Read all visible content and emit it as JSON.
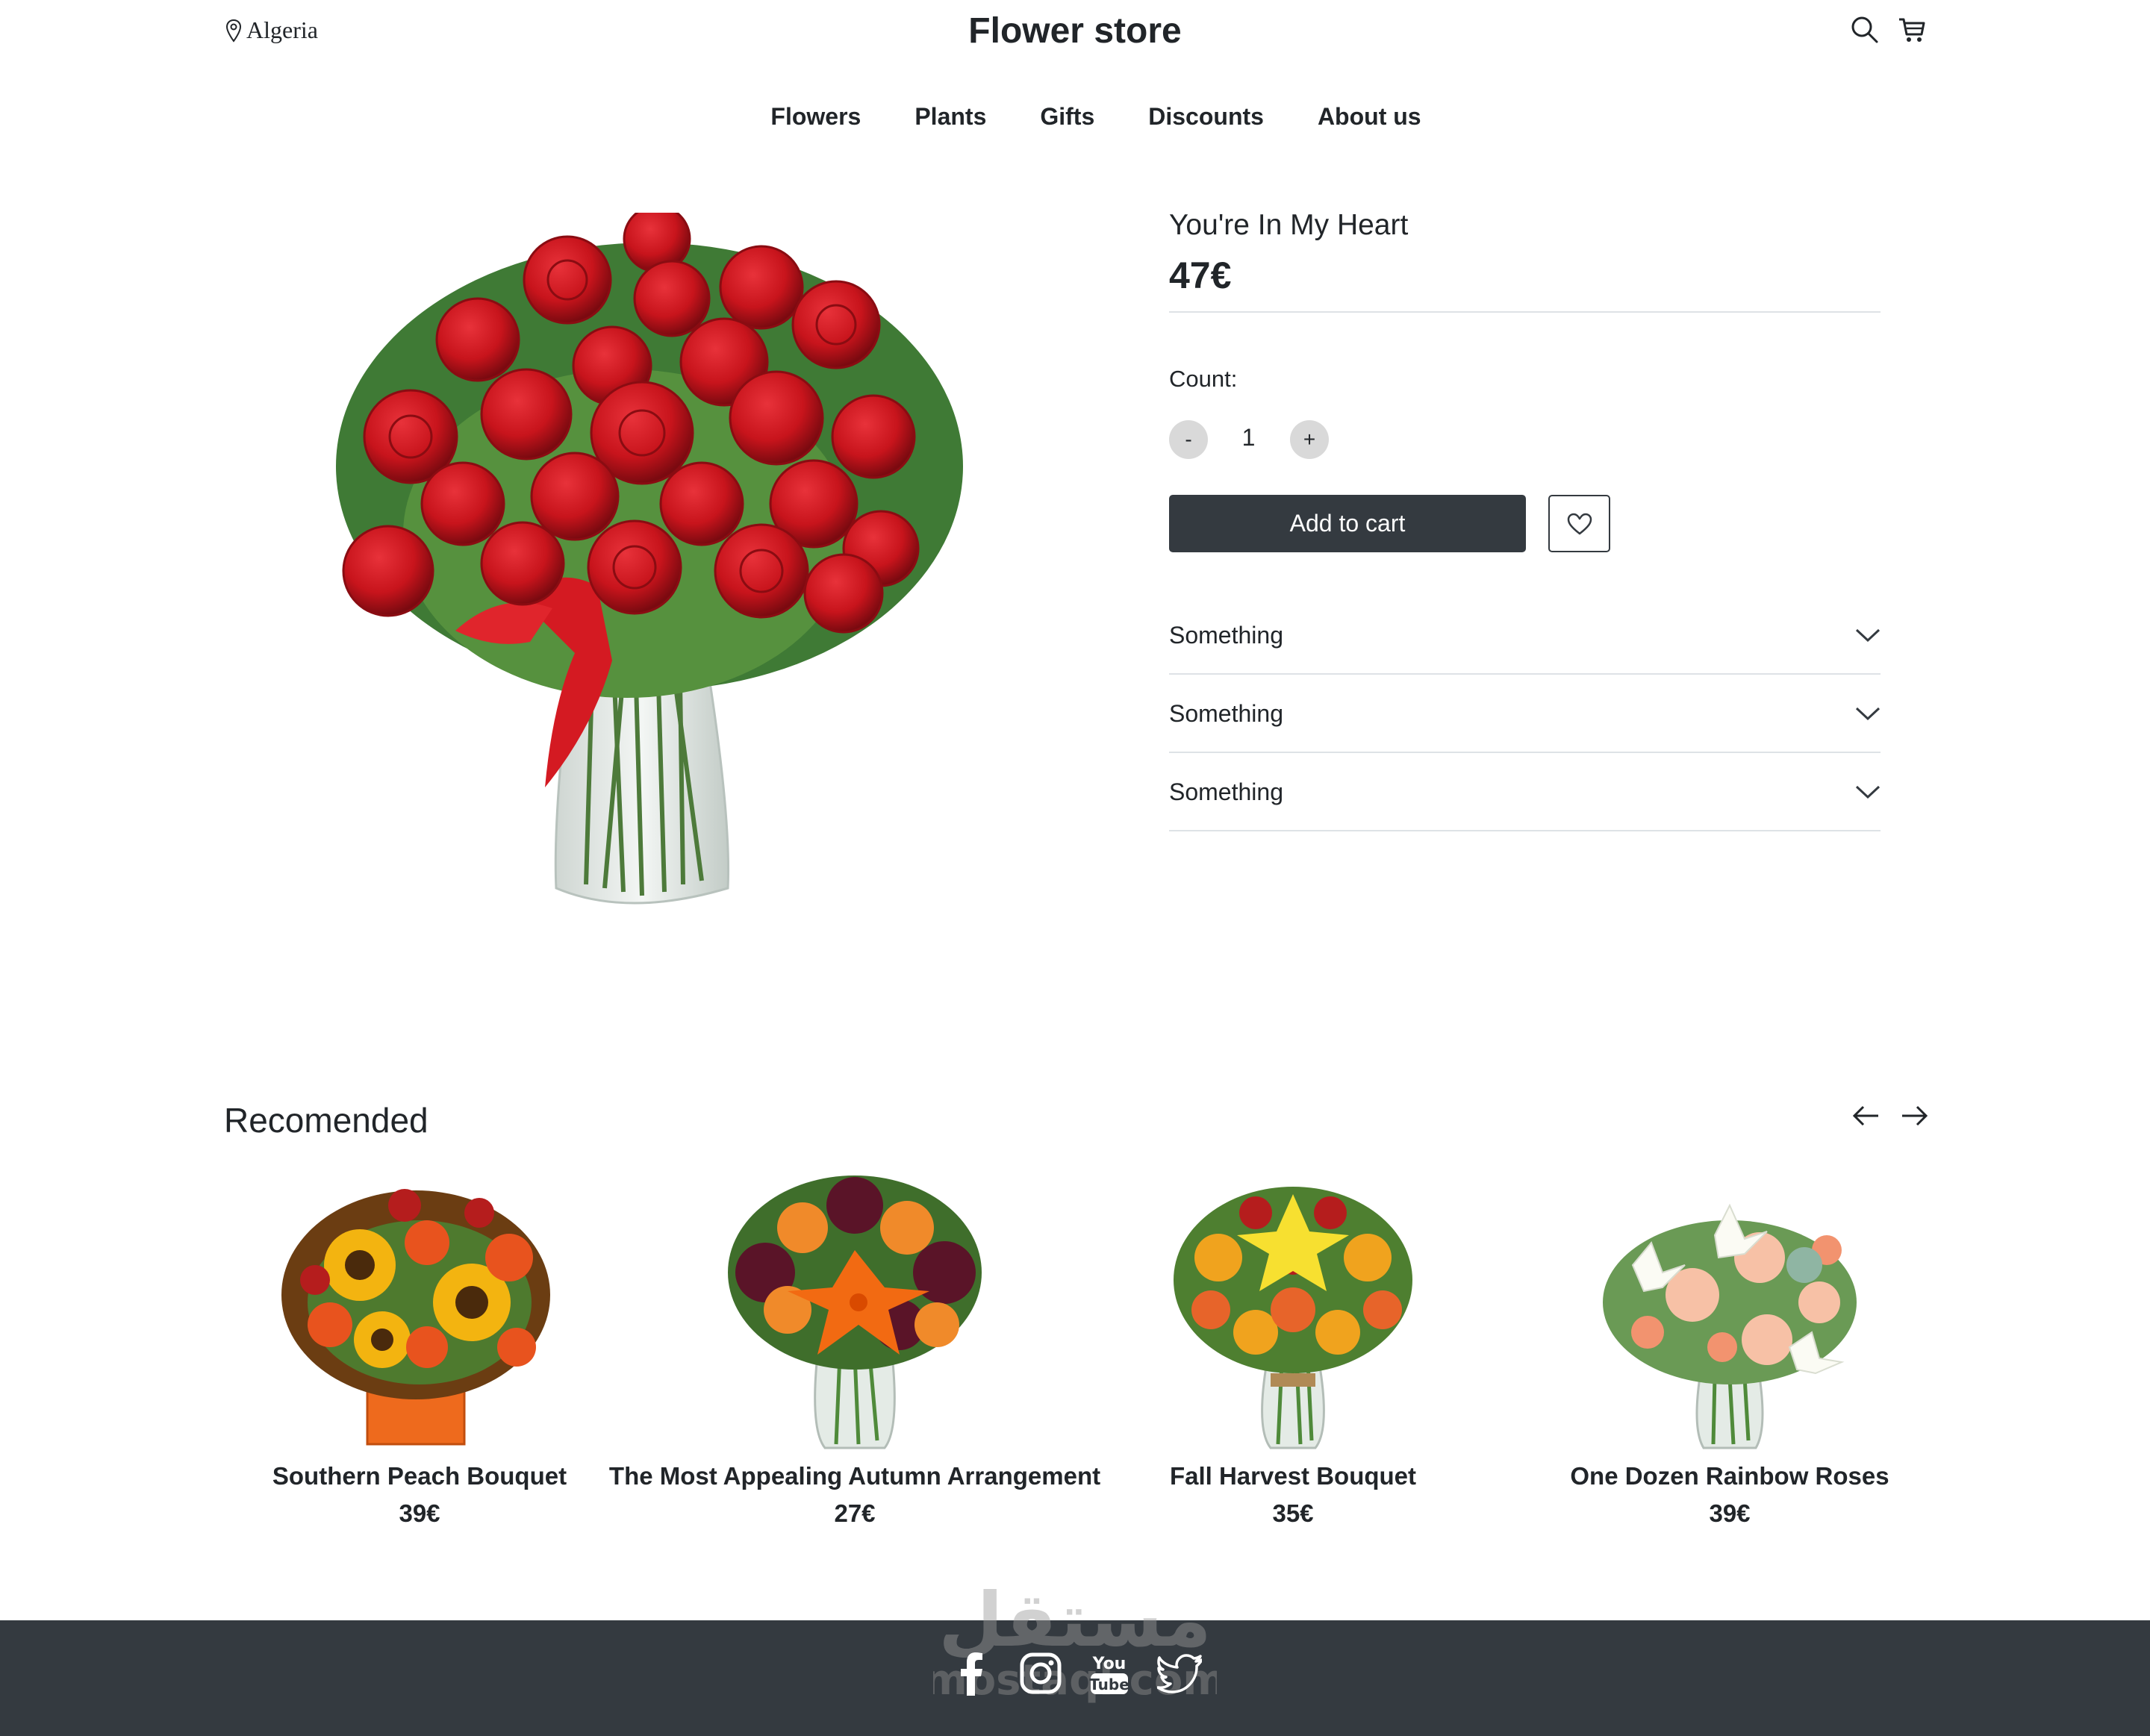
{
  "header": {
    "location": "Algeria",
    "brand": "Flower store",
    "icons": [
      "map-pin-icon",
      "search-icon",
      "cart-icon"
    ]
  },
  "nav": [
    {
      "label": "Flowers"
    },
    {
      "label": "Plants"
    },
    {
      "label": "Gifts"
    },
    {
      "label": "Discounts"
    },
    {
      "label": "About us"
    }
  ],
  "product": {
    "title": "You're In My Heart",
    "price": "47€",
    "count_label": "Count:",
    "count": "1",
    "minus_label": "-",
    "plus_label": "+",
    "add_to_cart": "Add to cart",
    "accordion": [
      {
        "label": "Something"
      },
      {
        "label": "Something"
      },
      {
        "label": "Something"
      }
    ]
  },
  "recommended": {
    "title": "Recomended",
    "items": [
      {
        "name": "Southern Peach Bouquet",
        "price": "39€"
      },
      {
        "name": "The Most Appealing Autumn Arrangement",
        "price": "27€"
      },
      {
        "name": "Fall Harvest Bouquet",
        "price": "35€"
      },
      {
        "name": "One Dozen Rainbow Roses",
        "price": "39€"
      }
    ]
  },
  "footer": {
    "social": [
      "facebook-icon",
      "instagram-icon",
      "youtube-icon",
      "twitter-icon"
    ],
    "youtube_text_top": "You",
    "youtube_text_bottom": "Tube"
  },
  "watermark": {
    "arabic": "مستقل",
    "latin": "mostaql.com"
  },
  "colors": {
    "dark": "#343a40",
    "text": "#212529",
    "rule": "#dee2e6",
    "round_button": "#d9d9d9",
    "rose_red": "#c8141c"
  }
}
